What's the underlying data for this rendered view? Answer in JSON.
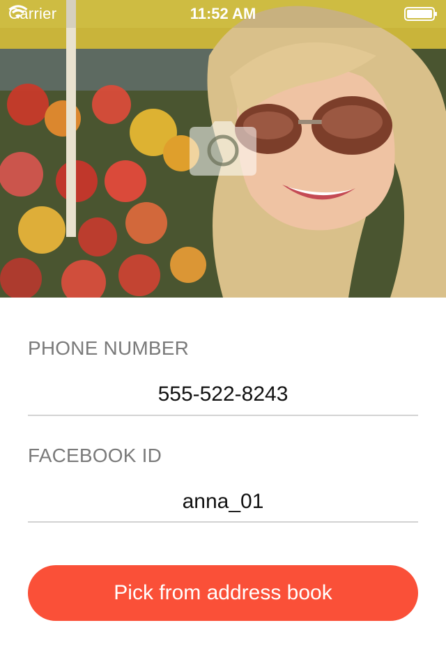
{
  "status_bar": {
    "carrier": "Carrier",
    "time": "11:52 AM",
    "battery_icon": "battery-full-icon",
    "wifi_icon": "wifi-icon"
  },
  "header": {
    "camera_icon": "camera-icon"
  },
  "form": {
    "phone": {
      "label": "PHONE NUMBER",
      "value": "555-522-8243"
    },
    "facebook": {
      "label": "FACEBOOK ID",
      "value": "anna_01"
    }
  },
  "actions": {
    "pick_label": "Pick from address book"
  },
  "colors": {
    "accent": "#fa5038",
    "label": "#7a7a7a",
    "divider": "#d2d2d2"
  }
}
